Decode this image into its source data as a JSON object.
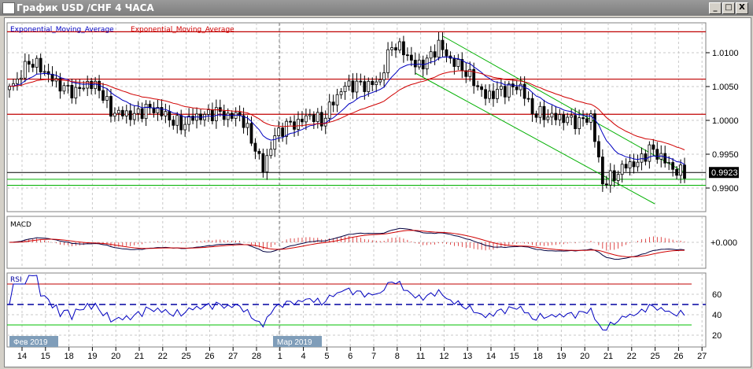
{
  "window": {
    "title": "График USD /CHF  4 ЧАСА",
    "minimize": "_",
    "maximize": "□",
    "close": "X"
  },
  "legend": {
    "ema_fast": "Exponential_Moving_Average",
    "ema_slow": "Exponential_Moving_Average"
  },
  "panels": {
    "macd": "MACD",
    "rsi": "RSI",
    "macd_zero": "+0.000"
  },
  "current_price": "0.9923",
  "month_labels": [
    "Фев 2019",
    "Мар 2019"
  ],
  "colors": {
    "ema_fast": "#0000c0",
    "ema_slow": "#d00000",
    "hline": "#c00000",
    "trend": "#00b000",
    "price": "#000000"
  },
  "chart_data": {
    "type": "candlestick",
    "title": "График USD /CHF  4 ЧАСА",
    "price_ticks": [
      "1.0100",
      "1.0050",
      "1.0000",
      "0.9950",
      "0.9900"
    ],
    "rsi_ticks": [
      "60",
      "40",
      "20"
    ],
    "x_ticks": [
      "14",
      "15",
      "18",
      "19",
      "20",
      "21",
      "22",
      "25",
      "26",
      "27",
      "28",
      "1",
      "4",
      "5",
      "6",
      "7",
      "8",
      "11",
      "12",
      "13",
      "14",
      "15",
      "18",
      "19",
      "20",
      "21",
      "22",
      "25",
      "26",
      "27"
    ],
    "half_day_closes": [
      1.006,
      1.009,
      1.008,
      1.006,
      1.0045,
      1.004,
      1.0055,
      1.005,
      1.0015,
      1.001,
      1.0005,
      1.0015,
      1.0015,
      1.0005,
      0.9995,
      1.0005,
      1.0005,
      1.001,
      1.0005,
      1.001,
      0.9975,
      0.993,
      0.9975,
      0.999,
      0.9995,
      1.001,
      1.0,
      1.003,
      1.005,
      1.005,
      1.005,
      1.006,
      1.0115,
      1.0105,
      1.008,
      1.0085,
      1.011,
      1.009,
      1.008,
      1.006,
      1.0035,
      1.004,
      1.0045,
      1.005,
      1.0015,
      1.001,
      1.0005,
      1.0,
      0.9995,
      1.0005,
      0.991,
      0.992,
      0.9935,
      0.9935,
      0.9955,
      0.9945,
      0.993,
      0.9923
    ],
    "horizontal_levels_red": [
      1.0131,
      1.0061,
      1.0009
    ],
    "horizontal_levels_green": [
      0.9913,
      0.9904
    ],
    "current_level": 0.9923,
    "rsi_levels": [
      70,
      50,
      30
    ],
    "ylim": [
      0.9868,
      1.0136
    ]
  }
}
